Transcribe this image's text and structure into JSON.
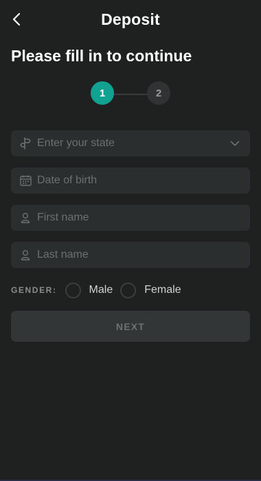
{
  "header": {
    "title": "Deposit",
    "back_icon": "chevron-left-icon"
  },
  "page": {
    "title": "Please fill in to continue"
  },
  "stepper": {
    "steps": [
      "1",
      "2"
    ],
    "active_step": 1,
    "active_color": "#12a291"
  },
  "form": {
    "state": {
      "placeholder": "Enter your state",
      "icon": "signpost-icon",
      "dropdown_icon": "chevron-down-icon"
    },
    "dob": {
      "placeholder": "Date of birth",
      "icon": "calendar-icon"
    },
    "first_name": {
      "placeholder": "First name",
      "icon": "user-icon"
    },
    "last_name": {
      "placeholder": "Last name",
      "icon": "user-icon"
    },
    "gender": {
      "label": "GENDER:",
      "options": [
        "Male",
        "Female"
      ]
    },
    "next_label": "NEXT"
  }
}
